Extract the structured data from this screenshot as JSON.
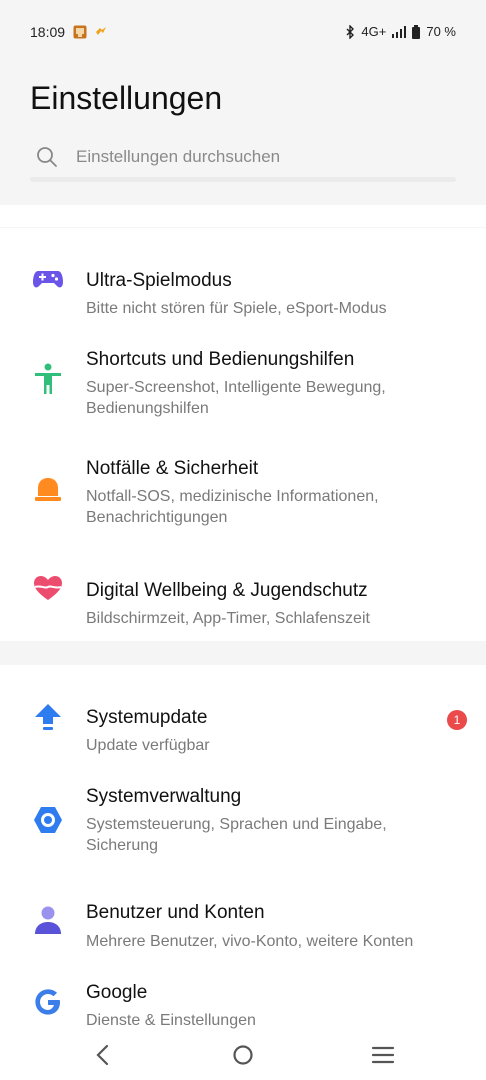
{
  "status_bar": {
    "time": "18:09",
    "network": "4G+",
    "battery": "70 %",
    "icons": [
      "app-notification-icon",
      "app-notification-icon-2",
      "bluetooth-icon",
      "signal-icon",
      "battery-icon"
    ]
  },
  "page": {
    "title": "Einstellungen"
  },
  "search": {
    "placeholder": "Einstellungen durchsuchen",
    "icon": "search-icon"
  },
  "groups": [
    {
      "items": [
        {
          "title": "Ultra-Spielmodus",
          "subtitle": "Bitte nicht stören für Spiele, eSport-Modus",
          "icon": "gamepad-icon",
          "color": "#6b55e8"
        },
        {
          "title": "Shortcuts und Bedienungshilfen",
          "subtitle": "Super-Screenshot, Intelligente Bewegung, Bedienungshilfen",
          "icon": "accessibility-icon",
          "color": "#2fbf7a"
        },
        {
          "title": "Notfälle & Sicherheit",
          "subtitle": "Notfall-SOS, medizinische Informationen, Benachrichtigungen",
          "icon": "emergency-light-icon",
          "color": "#ff8a1f"
        },
        {
          "title": "Digital Wellbeing & Jugendschutz",
          "subtitle": "Bildschirmzeit, App-Timer, Schlafenszeit",
          "icon": "heart-icon",
          "color": "#ec4d6f"
        }
      ]
    },
    {
      "items": [
        {
          "title": "Systemupdate",
          "subtitle": "Update verfügbar",
          "icon": "upload-arrow-icon",
          "color": "#2f7cf0",
          "badge": "1"
        },
        {
          "title": "Systemverwaltung",
          "subtitle": "Systemsteuerung, Sprachen und Eingabe, Sicherung",
          "icon": "hexagon-icon",
          "color": "#2f7cf0"
        },
        {
          "title": "Benutzer und Konten",
          "subtitle": "Mehrere Benutzer, vivo-Konto, weitere Konten",
          "icon": "user-icon",
          "color": "#5a52d8"
        },
        {
          "title": "Google",
          "subtitle": "Dienste & Einstellungen",
          "icon": "google-icon",
          "color": "#3b7de9"
        }
      ]
    }
  ],
  "nav_bar": {
    "buttons": [
      "back-icon",
      "home-icon",
      "menu-icon"
    ]
  },
  "colors": {
    "background": "#f5f5f5",
    "card": "#ffffff",
    "badge": "#ea4a4a"
  }
}
